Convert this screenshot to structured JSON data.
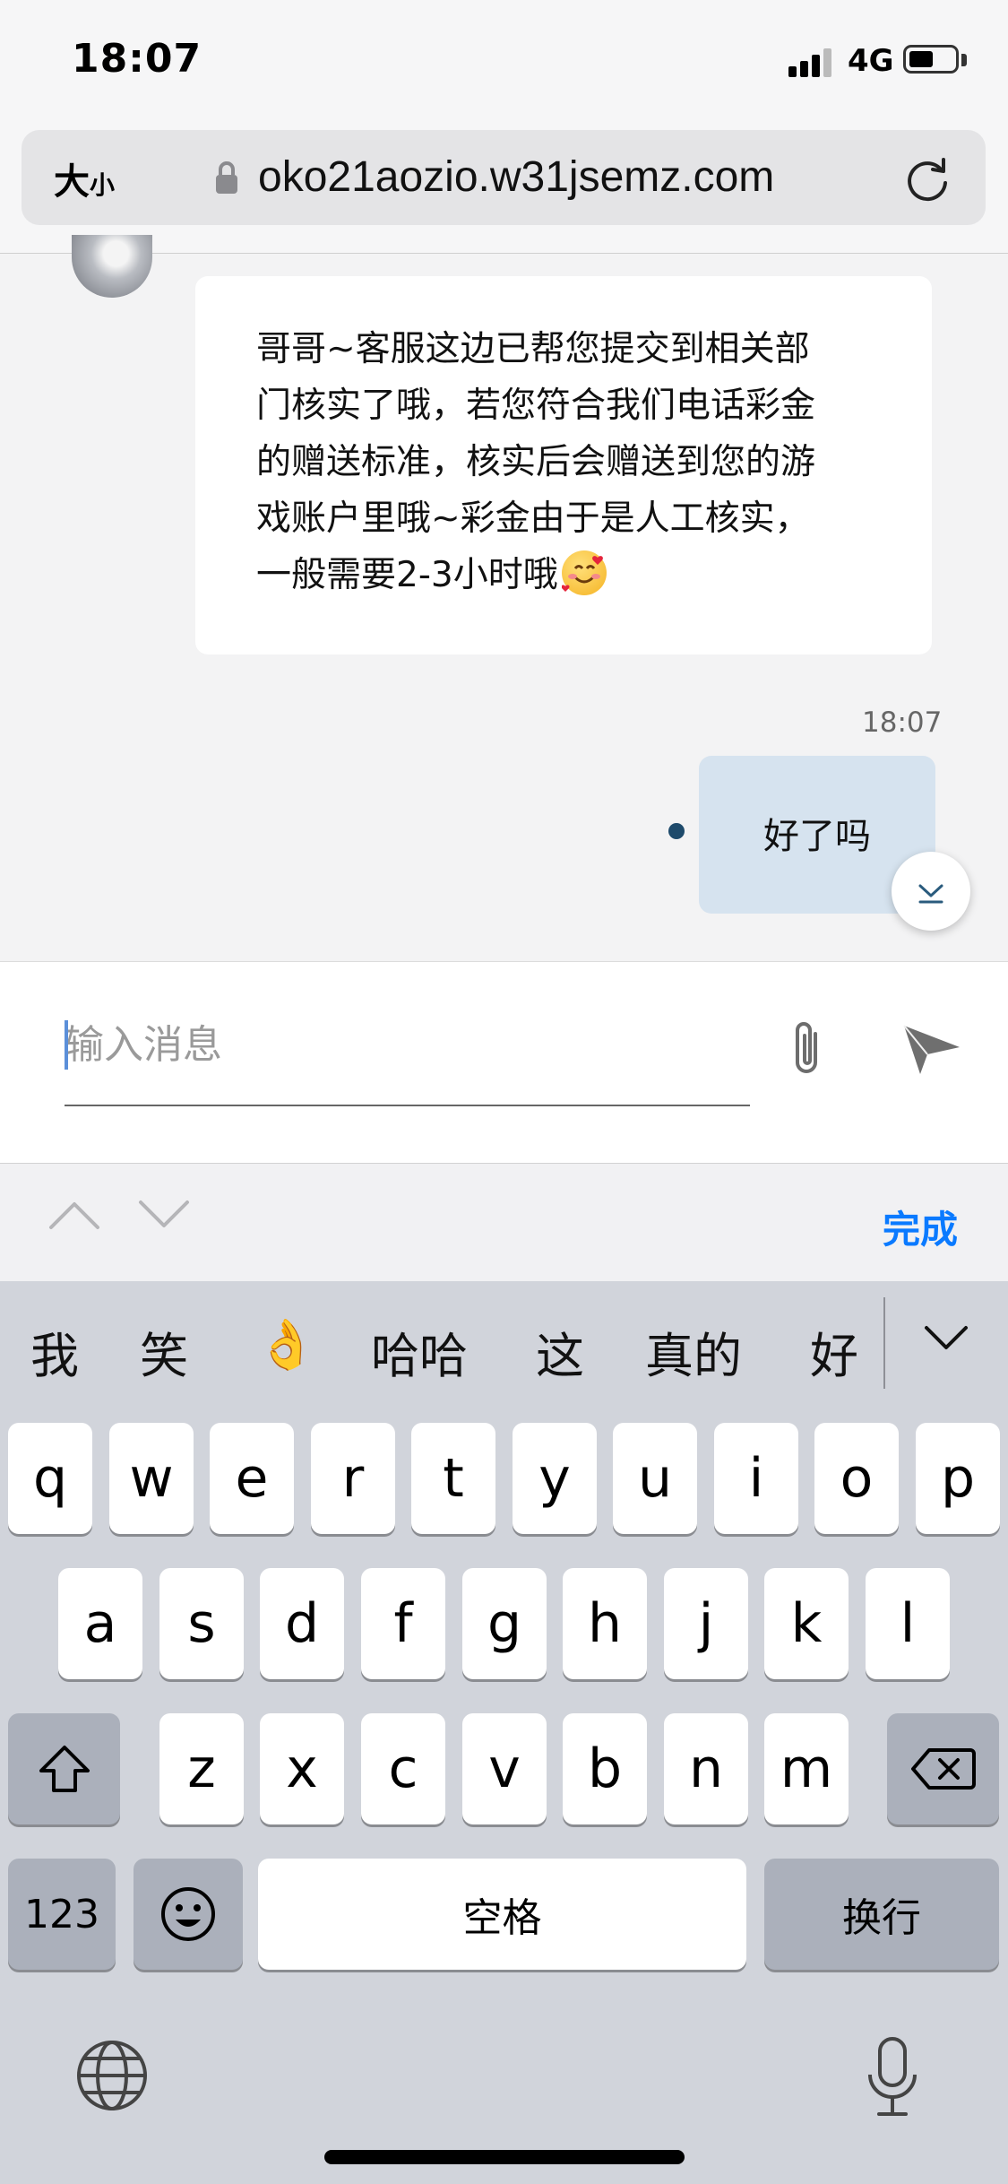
{
  "status_bar": {
    "time": "18:07",
    "network": "4G"
  },
  "browser": {
    "text_size_big": "大",
    "text_size_small": "小",
    "url": "oko21aozio.w31jsemz.com"
  },
  "chat": {
    "incoming_message": "哥哥~客服这边已帮您提交到相关部\n门核实了哦，若您符合我们电话彩金\n的赠送标准，核实后会赠送到您的游\n戏账户里哦~彩金由于是人工核实，\n一般需要2-3小时哦",
    "timestamp": "18:07",
    "outgoing_message": "好了吗"
  },
  "composer": {
    "placeholder": "输入消息"
  },
  "keyboard_toolbar": {
    "done_label": "完成"
  },
  "keyboard": {
    "candidates": [
      "我",
      "笑",
      "👌",
      "哈哈",
      "这",
      "真的",
      "好"
    ],
    "row1": [
      "q",
      "w",
      "e",
      "r",
      "t",
      "y",
      "u",
      "i",
      "o",
      "p"
    ],
    "row2": [
      "a",
      "s",
      "d",
      "f",
      "g",
      "h",
      "j",
      "k",
      "l"
    ],
    "row3": [
      "z",
      "x",
      "c",
      "v",
      "b",
      "n",
      "m"
    ],
    "numbers_key": "123",
    "space_label": "空格",
    "return_label": "换行"
  }
}
